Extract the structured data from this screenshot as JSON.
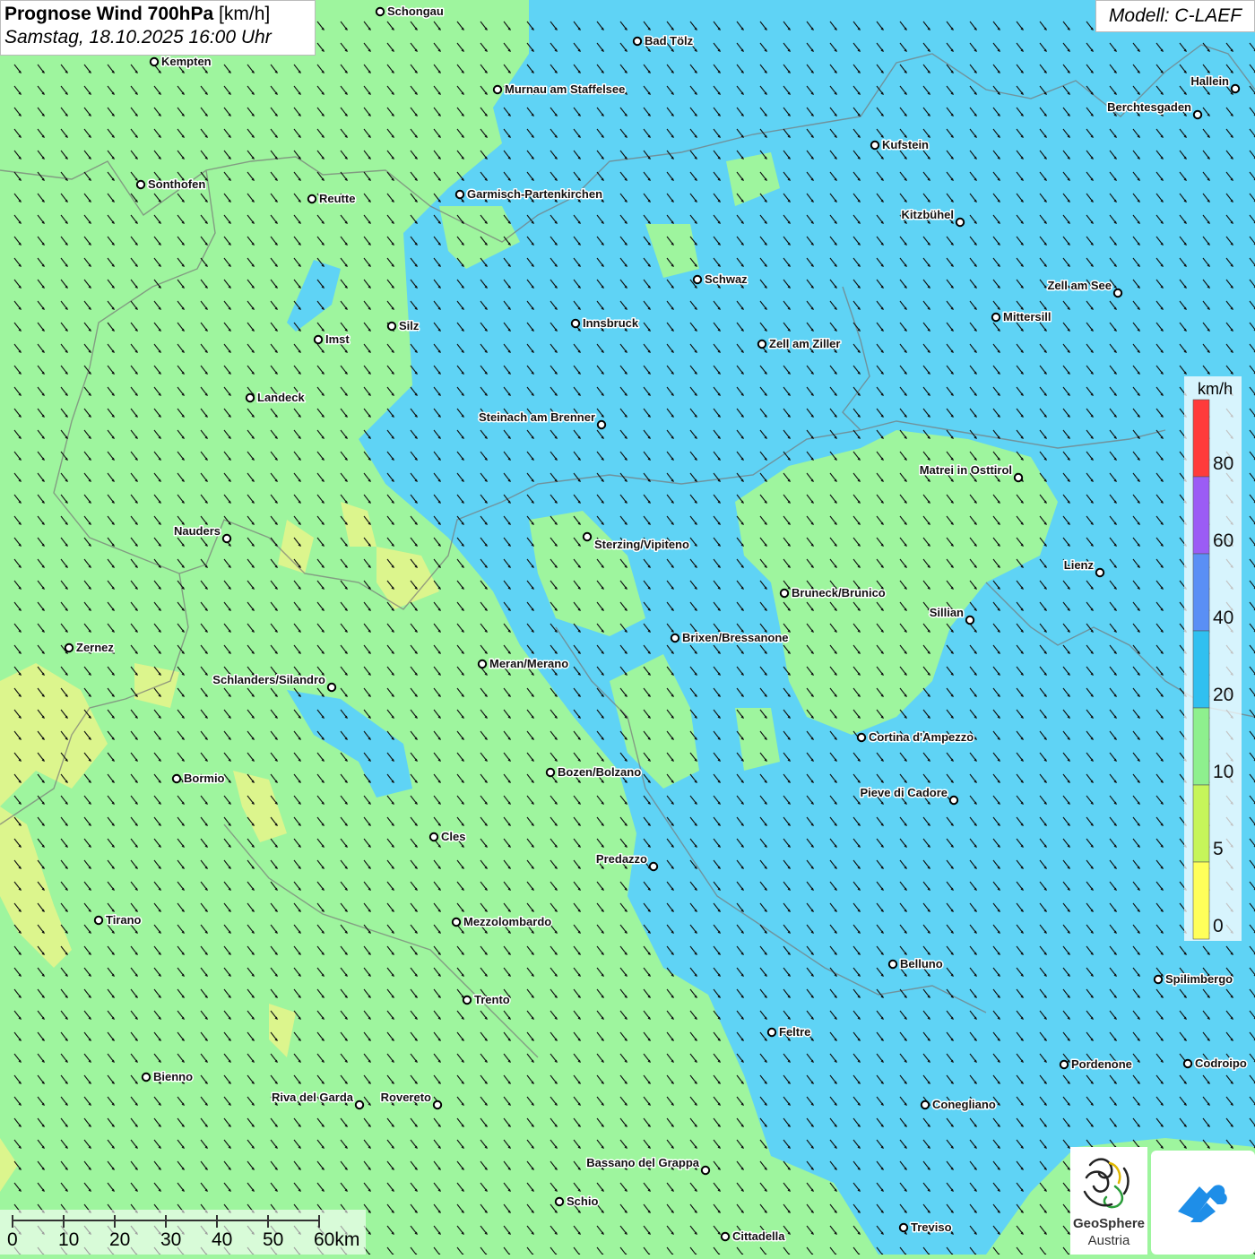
{
  "header": {
    "title_bold": "Prognose Wind 700hPa",
    "title_unit": "[km/h]",
    "datetime": "Samstag, 18.10.2025 16:00 Uhr",
    "model": "Modell: C-LAEF"
  },
  "legend": {
    "unit": "km/h",
    "labels": [
      "80",
      "60",
      "40",
      "20",
      "10",
      "5",
      "0"
    ],
    "colors": [
      "#ff3b3b",
      "#9b5cf5",
      "#5a8ff5",
      "#30c0f0",
      "#8ef08e",
      "#c6f55a",
      "#ffff5a"
    ]
  },
  "colors": {
    "wind_low": "#9ef59e",
    "wind_mid": "#5fd3f5",
    "wind_yellow": "#e6f58a"
  },
  "scalebar": {
    "labels": [
      "0",
      "10",
      "20",
      "30",
      "40",
      "50",
      "60km"
    ]
  },
  "logos": {
    "geosphere_line1": "GeoSphere",
    "geosphere_line2": "Austria",
    "geosphere_icon": "geosphere-swirl-icon",
    "app_icon": "cloud-arrow-icon"
  },
  "cities": [
    {
      "name": "Schongau"
    },
    {
      "name": "Bad Tölz"
    },
    {
      "name": "Kempten"
    },
    {
      "name": "Murnau am Staffelsee"
    },
    {
      "name": "Hallein"
    },
    {
      "name": "Berchtesgaden"
    },
    {
      "name": "Kufstein"
    },
    {
      "name": "Sonthofen"
    },
    {
      "name": "Reutte"
    },
    {
      "name": "Garmisch-Partenkirchen"
    },
    {
      "name": "Kitzbühel"
    },
    {
      "name": "Schwaz"
    },
    {
      "name": "Zell am See"
    },
    {
      "name": "Mittersill"
    },
    {
      "name": "Silz"
    },
    {
      "name": "Innsbruck"
    },
    {
      "name": "Imst"
    },
    {
      "name": "Zell am Ziller"
    },
    {
      "name": "Landeck"
    },
    {
      "name": "Steinach am Brenner"
    },
    {
      "name": "Matrei in Osttirol"
    },
    {
      "name": "Nauders"
    },
    {
      "name": "Sterzing/Vipiteno"
    },
    {
      "name": "Lienz"
    },
    {
      "name": "Bruneck/Brunico"
    },
    {
      "name": "Sillian"
    },
    {
      "name": "Zernez"
    },
    {
      "name": "Brixen/Bressanone"
    },
    {
      "name": "Meran/Merano"
    },
    {
      "name": "Schlanders/Silandro"
    },
    {
      "name": "Cortina d'Ampezzo"
    },
    {
      "name": "Bozen/Bolzano"
    },
    {
      "name": "Bormio"
    },
    {
      "name": "Pieve di Cadore"
    },
    {
      "name": "Cles"
    },
    {
      "name": "Predazzo"
    },
    {
      "name": "Tirano"
    },
    {
      "name": "Mezzolombardo"
    },
    {
      "name": "Belluno"
    },
    {
      "name": "Spilimbergo"
    },
    {
      "name": "Trento"
    },
    {
      "name": "Feltre"
    },
    {
      "name": "Pordenone"
    },
    {
      "name": "Codroipo"
    },
    {
      "name": "Bienno"
    },
    {
      "name": "Riva del Garda"
    },
    {
      "name": "Rovereto"
    },
    {
      "name": "Conegliano"
    },
    {
      "name": "Bassano del Grappa"
    },
    {
      "name": "Schio"
    },
    {
      "name": "Treviso"
    },
    {
      "name": "Cittadella"
    }
  ]
}
